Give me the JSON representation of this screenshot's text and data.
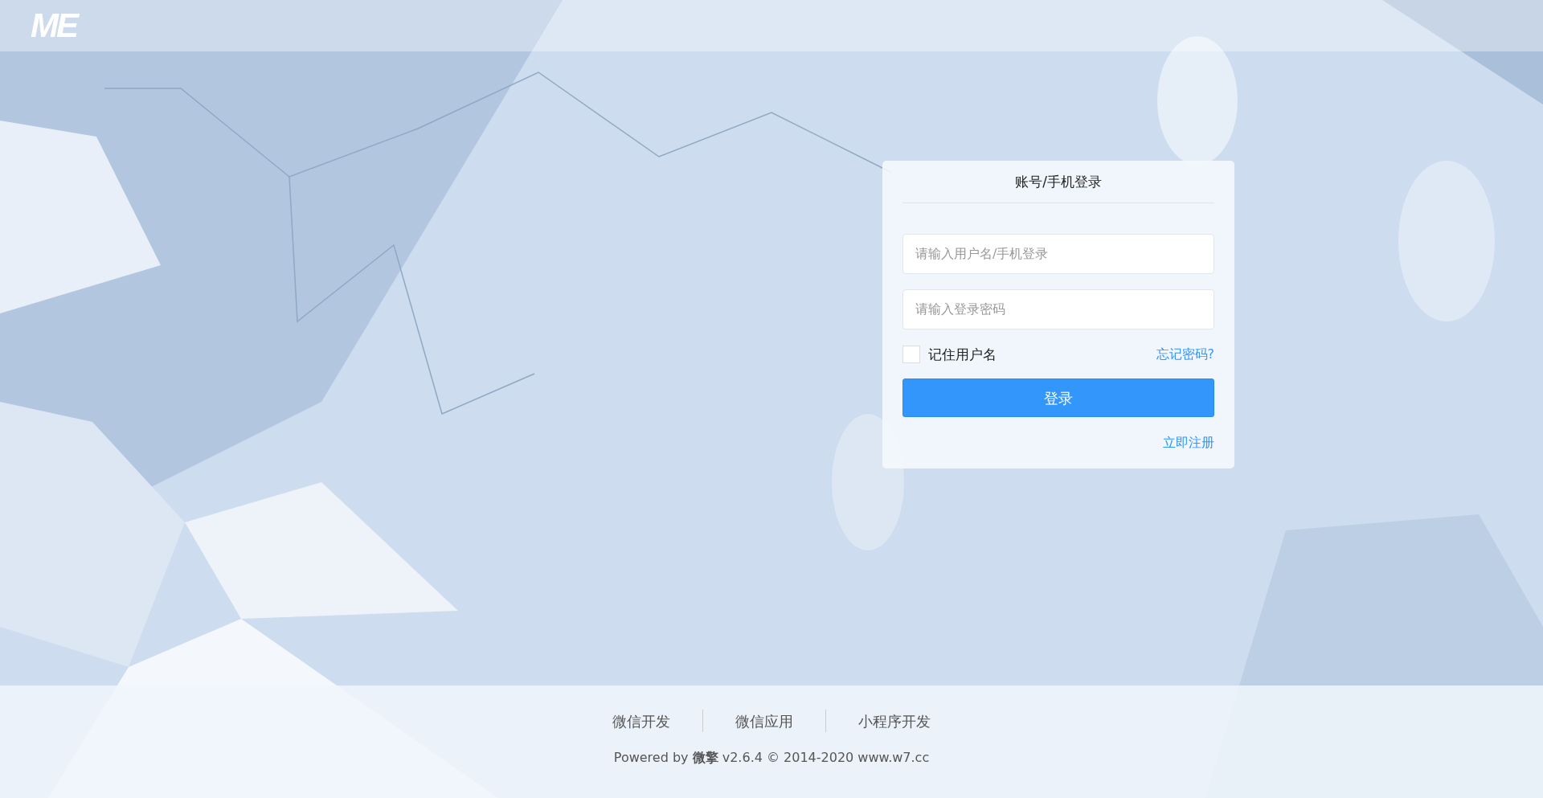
{
  "header": {
    "logo": "ME"
  },
  "login_card": {
    "title": "账号/手机登录",
    "username_field": {
      "placeholder": "请输入用户名/手机登录"
    },
    "password_field": {
      "placeholder": "请输入登录密码"
    },
    "remember": {
      "label": "记住用户名",
      "checked": false
    },
    "forgot_link": "忘记密码?",
    "submit_button": "登录",
    "register_link": "立即注册"
  },
  "footer": {
    "links": [
      "微信开发",
      "微信应用",
      "小程序开发"
    ],
    "powered": "Powered by **微擎** v2.6.4 © 2014-2020 www.w7.cc"
  }
}
